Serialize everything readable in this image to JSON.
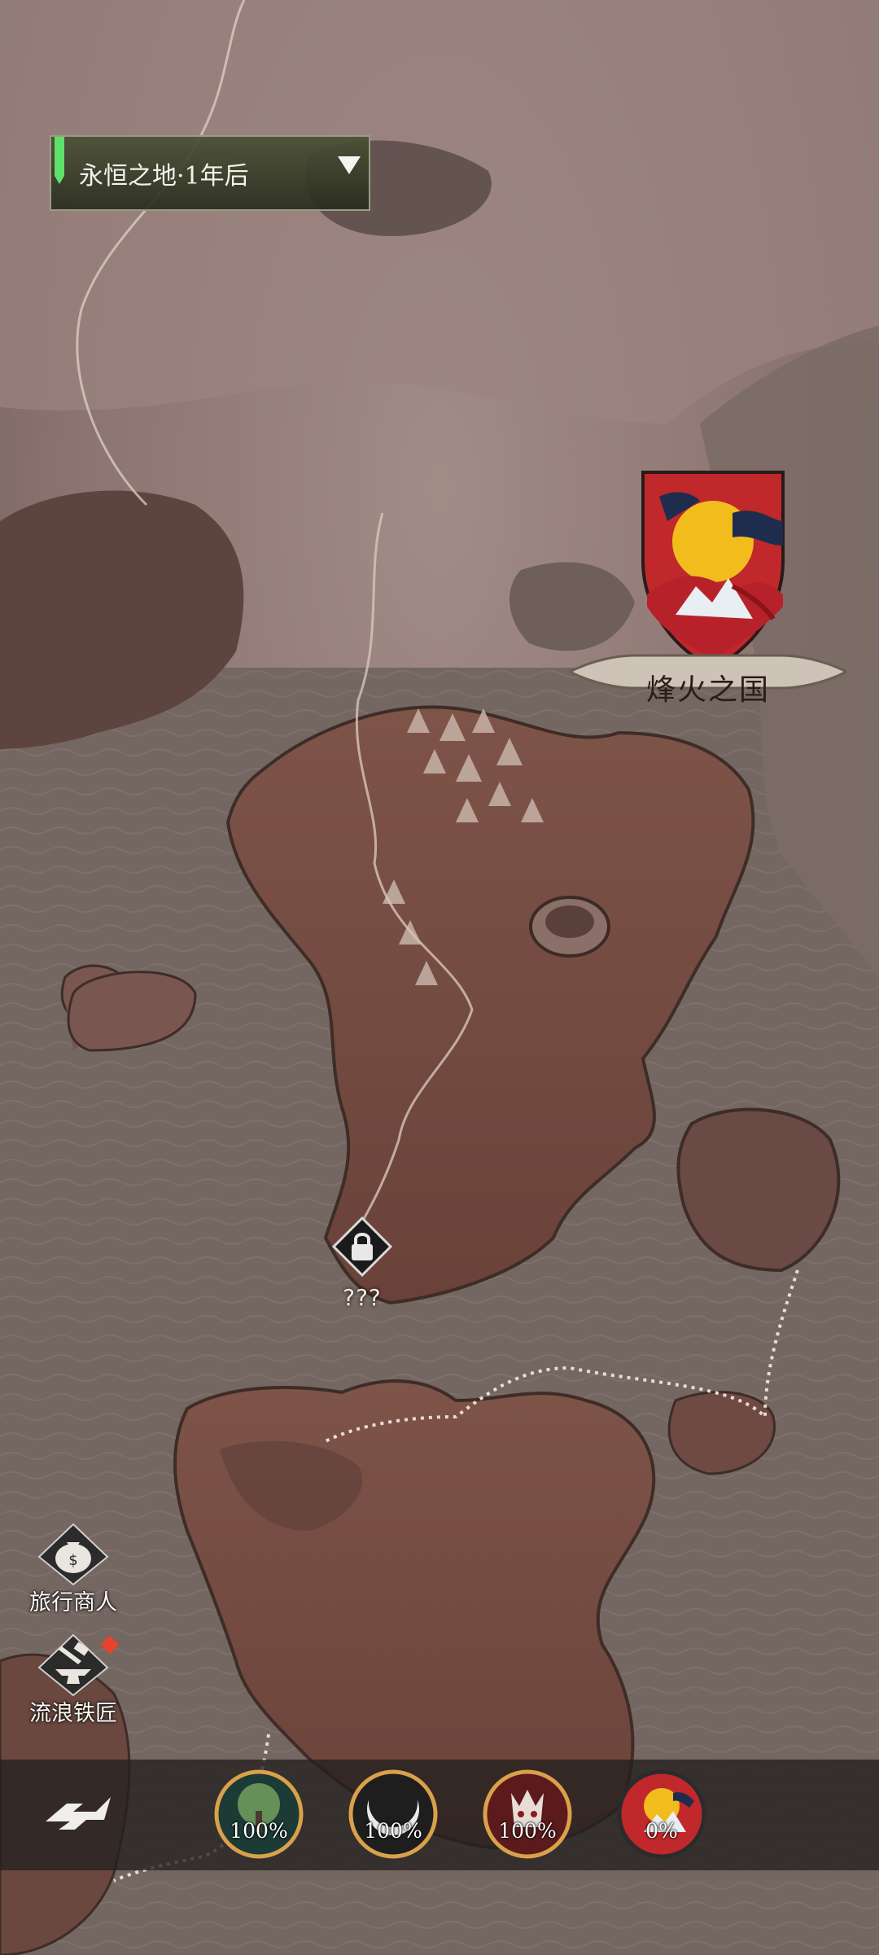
{
  "region_selector": {
    "label": "永恒之地·1年后",
    "icon": "chevron-down-icon"
  },
  "faction": {
    "name": "烽火之国",
    "icon": "sun-mountain-crest-icon",
    "color": "#c0282b"
  },
  "locked_location": {
    "label": "???",
    "icon": "lock-icon"
  },
  "side_menu": [
    {
      "label": "旅行商人",
      "icon": "money-bag-icon"
    },
    {
      "label": "流浪铁匠",
      "icon": "anvil-hammer-icon",
      "notification": true
    }
  ],
  "bottom_bar": {
    "home_icon": "return-emblem-icon",
    "stats": [
      {
        "value": "100%",
        "icon": "tree-icon",
        "ring_color": "#d9a14a"
      },
      {
        "value": "100%",
        "icon": "moon-crescent-icon",
        "ring_color": "#d9a14a"
      },
      {
        "value": "100%",
        "icon": "red-demon-icon",
        "ring_color": "#d9a14a"
      },
      {
        "value": "0%",
        "icon": "sun-mountain-crest-icon",
        "ring_color": "#2b2b2b"
      }
    ]
  }
}
